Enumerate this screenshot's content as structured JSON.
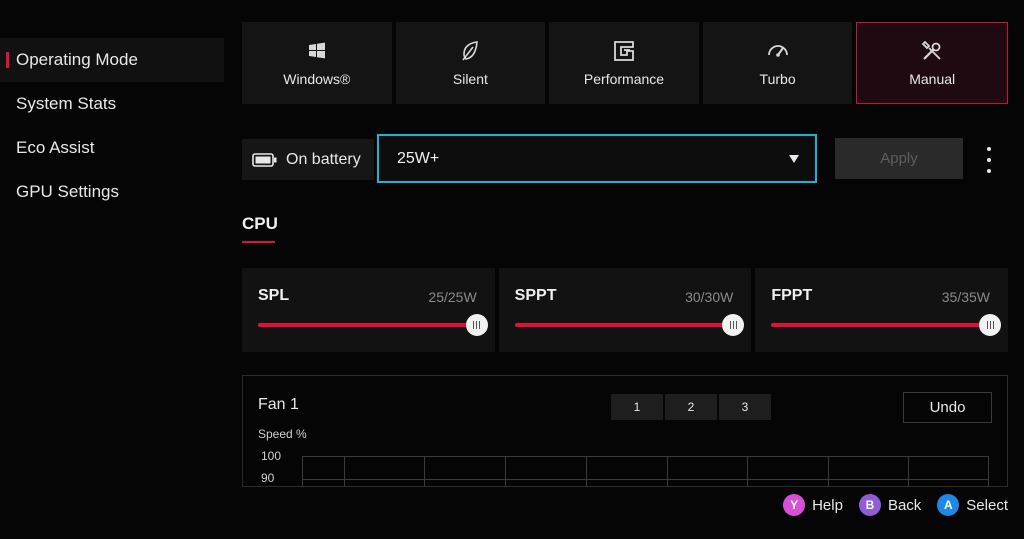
{
  "sidebar": {
    "items": [
      {
        "label": "Operating Mode",
        "active": true
      },
      {
        "label": "System Stats",
        "active": false
      },
      {
        "label": "Eco Assist",
        "active": false
      },
      {
        "label": "GPU Settings",
        "active": false
      }
    ]
  },
  "modes": [
    {
      "label": "Windows®",
      "icon": "windows-icon",
      "active": false
    },
    {
      "label": "Silent",
      "icon": "leaf-icon",
      "active": false
    },
    {
      "label": "Performance",
      "icon": "performance-icon",
      "active": false
    },
    {
      "label": "Turbo",
      "icon": "speedometer-icon",
      "active": false
    },
    {
      "label": "Manual",
      "icon": "wrench-screwdriver-icon",
      "active": true
    }
  ],
  "power": {
    "source_label": "On battery",
    "source_icon": "battery-icon",
    "profile_value": "25W+",
    "apply_label": "Apply"
  },
  "cpu_tab": "CPU",
  "sliders": [
    {
      "name": "SPL",
      "value_text": "25/25W",
      "level": 1.0
    },
    {
      "name": "SPPT",
      "value_text": "30/30W",
      "level": 1.0
    },
    {
      "name": "FPPT",
      "value_text": "35/35W",
      "level": 1.0
    }
  ],
  "fan": {
    "title": "Fan 1",
    "presets": [
      "1",
      "2",
      "3"
    ],
    "undo_label": "Undo",
    "y_axis_label": "Speed %",
    "y_ticks": [
      "100",
      "90"
    ]
  },
  "footer": [
    {
      "key": "Y",
      "label": "Help",
      "color": "#d84fd8"
    },
    {
      "key": "B",
      "label": "Back",
      "color": "#8f5cd6"
    },
    {
      "key": "A",
      "label": "Select",
      "color": "#1e88e5"
    }
  ],
  "colors": {
    "accent": "#e0103a",
    "focus": "#1fb2d8"
  }
}
